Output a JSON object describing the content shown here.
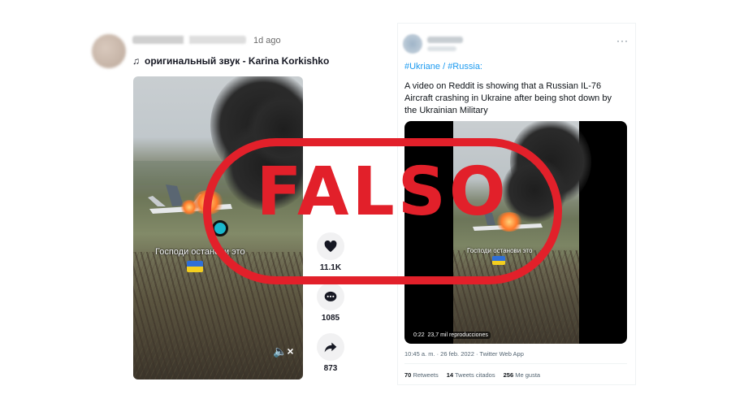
{
  "tiktok": {
    "time_ago": "1d ago",
    "sound": "оригинальный звук - Karina Korkishko",
    "video_caption": "Господи останови это",
    "likes": "11.1K",
    "comments": "1085",
    "shares": "873"
  },
  "twitter": {
    "hashtags": "#Ukriane / #Russia:",
    "body": "A video on Reddit is showing that a Russian IL-76 Aircraft crashing in Ukraine after being shot down by the Ukrainian Military",
    "video_caption": "Господи останови это",
    "video_time": "0:22",
    "views": "23,7 mil reproducciones",
    "meta": "10:45 a. m. · 26 feb. 2022 · Twitter Web App",
    "retweets_count": "70",
    "retweets_label": "Retweets",
    "quotes_count": "14",
    "quotes_label": "Tweets citados",
    "likes_count": "256",
    "likes_label": "Me gusta"
  },
  "stamp": {
    "label": "FALSO",
    "color": "#e2202a"
  },
  "icons": [
    "music-note-icon",
    "heart-icon",
    "comment-icon",
    "share-icon",
    "mute-icon",
    "more-icon"
  ]
}
